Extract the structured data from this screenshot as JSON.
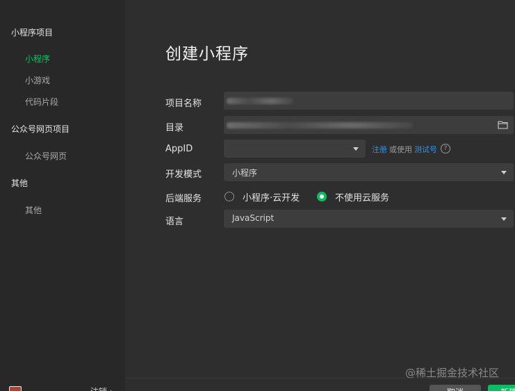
{
  "sidebar": {
    "groups": [
      {
        "label": "小程序项目",
        "items": [
          "小程序",
          "小游戏",
          "代码片段"
        ]
      },
      {
        "label": "公众号网页项目",
        "items": [
          "公众号网页"
        ]
      },
      {
        "label": "其他",
        "items": [
          "其他"
        ]
      }
    ],
    "footer_link": "注销 ›"
  },
  "main": {
    "title": "创建小程序",
    "fields": {
      "project_name_label": "项目名称",
      "directory_label": "目录",
      "appid_label": "AppID",
      "dev_mode_label": "开发模式",
      "dev_mode_value": "小程序",
      "backend_label": "后端服务",
      "backend_options": [
        "小程序·云开发",
        "不使用云服务"
      ],
      "backend_selected": "不使用云服务",
      "language_label": "语言",
      "language_value": "JavaScript"
    },
    "appid_links": {
      "register": "注册",
      "or_use": "或使用",
      "test_account": "测试号"
    },
    "buttons": {
      "cancel": "取消",
      "create": "新建"
    },
    "watermark": "@稀土掘金技术社区"
  },
  "colors": {
    "accent": "#07c160",
    "link": "#3c8fd8",
    "background": "#2e2e2e",
    "sidebar": "#282828"
  }
}
